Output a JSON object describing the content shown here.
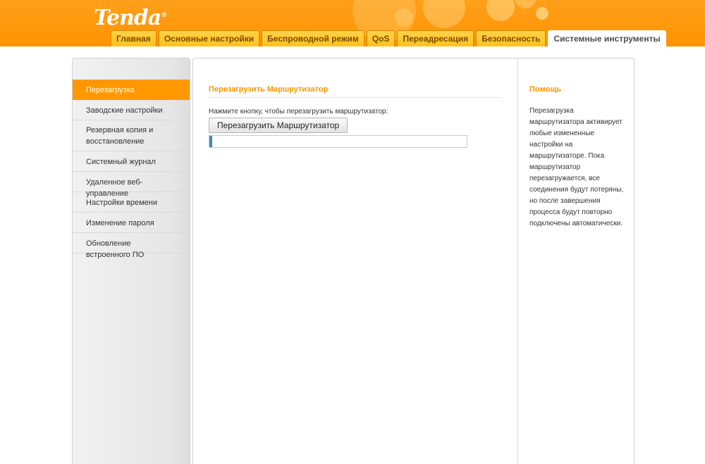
{
  "header": {
    "logo_text": "Tenda",
    "logo_mark": "®",
    "tabs": [
      {
        "label": "Главная",
        "active": false
      },
      {
        "label": "Основные настройки",
        "active": false
      },
      {
        "label": "Беспроводной режим",
        "active": false
      },
      {
        "label": "QoS",
        "active": false
      },
      {
        "label": "Переадресация",
        "active": false
      },
      {
        "label": "Безопасность",
        "active": false
      },
      {
        "label": "Системные инструменты",
        "active": true
      }
    ]
  },
  "sidebar": {
    "items": [
      {
        "label": "Перезагрузка",
        "active": true
      },
      {
        "label": "Заводские настройки",
        "active": false
      },
      {
        "label": "Резервная копия и восстановление",
        "active": false
      },
      {
        "label": "Системный журнал",
        "active": false
      },
      {
        "label": "Удаленное веб-управление",
        "active": false
      },
      {
        "label": "Настройки времени",
        "active": false
      },
      {
        "label": "Изменение пароля",
        "active": false
      },
      {
        "label": "Обновление встроенного ПО",
        "active": false
      }
    ]
  },
  "main": {
    "title": "Перезагрузить Маршрутизатор",
    "prompt": "Нажмите кнопку, чтобы перезагрузить маршрутизатор:",
    "button_label": "Перезагрузить Маршрутизатор",
    "progress_percent": 1
  },
  "help": {
    "title": "Помощь",
    "text": "Перезагрузка маршрутизатора активирует любые измененные настройки на маршрутизаторе. Пока маршрутизатор перезагружается, все соединения будут потеряны, но после завершения процесса будут повторно подключены автоматически."
  },
  "colors": {
    "header_orange": "#ff9800",
    "accent_title": "#f39800",
    "progress_fill": "#3c8fa8"
  }
}
